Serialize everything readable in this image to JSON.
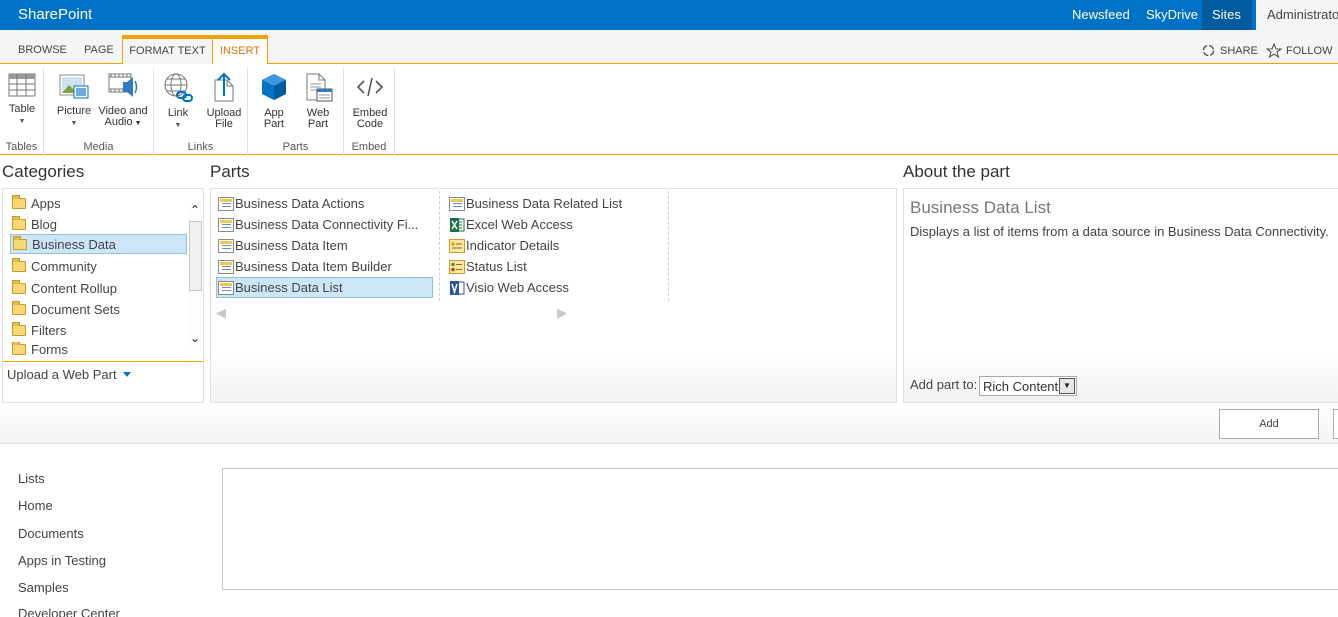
{
  "suite_bar": {
    "brand": "SharePoint",
    "links": [
      "Newsfeed",
      "SkyDrive",
      "Sites"
    ],
    "user": "Administrato"
  },
  "ribbon_tabs": {
    "browse": "BROWSE",
    "page": "PAGE",
    "format_text": "FORMAT TEXT",
    "insert": "INSERT",
    "share": "SHARE",
    "follow": "FOLLOW"
  },
  "ribbon": {
    "groups": {
      "tables": "Tables",
      "media": "Media",
      "links": "Links",
      "parts": "Parts",
      "embed": "Embed"
    },
    "buttons": {
      "table": "Table",
      "picture": "Picture",
      "video_line1": "Video and",
      "video_line2": "Audio",
      "link": "Link",
      "upload_line1": "Upload",
      "upload_line2": "File",
      "app_line1": "App",
      "app_line2": "Part",
      "web_line1": "Web",
      "web_line2": "Part",
      "embed_line1": "Embed",
      "embed_line2": "Code"
    }
  },
  "categories": {
    "title": "Categories",
    "items": [
      "Apps",
      "Blog",
      "Business Data",
      "Community",
      "Content Rollup",
      "Document Sets",
      "Filters",
      "Forms"
    ],
    "selected": "Business Data",
    "upload_label": "Upload a Web Part"
  },
  "parts": {
    "title": "Parts",
    "column1": [
      "Business Data Actions",
      "Business Data Connectivity Fi...",
      "Business Data Item",
      "Business Data Item Builder",
      "Business Data List"
    ],
    "column2": [
      "Business Data Related List",
      "Excel Web Access",
      "Indicator Details",
      "Status List",
      "Visio Web Access"
    ],
    "selected": "Business Data List"
  },
  "about": {
    "title": "About the part",
    "part_name": "Business Data List",
    "description": "Displays a list of items from a data source in Business Data Connectivity.",
    "add_to_label": "Add part to:",
    "add_to_value": "Rich Content"
  },
  "actions": {
    "add": "Add"
  },
  "quick_launch": [
    "Lists",
    "Home",
    "Documents",
    "Apps in Testing",
    "Samples",
    "Developer Center"
  ],
  "colors": {
    "suite_bar": "#0072c6",
    "accent": "#f2a300",
    "selection": "#cde6f7"
  }
}
